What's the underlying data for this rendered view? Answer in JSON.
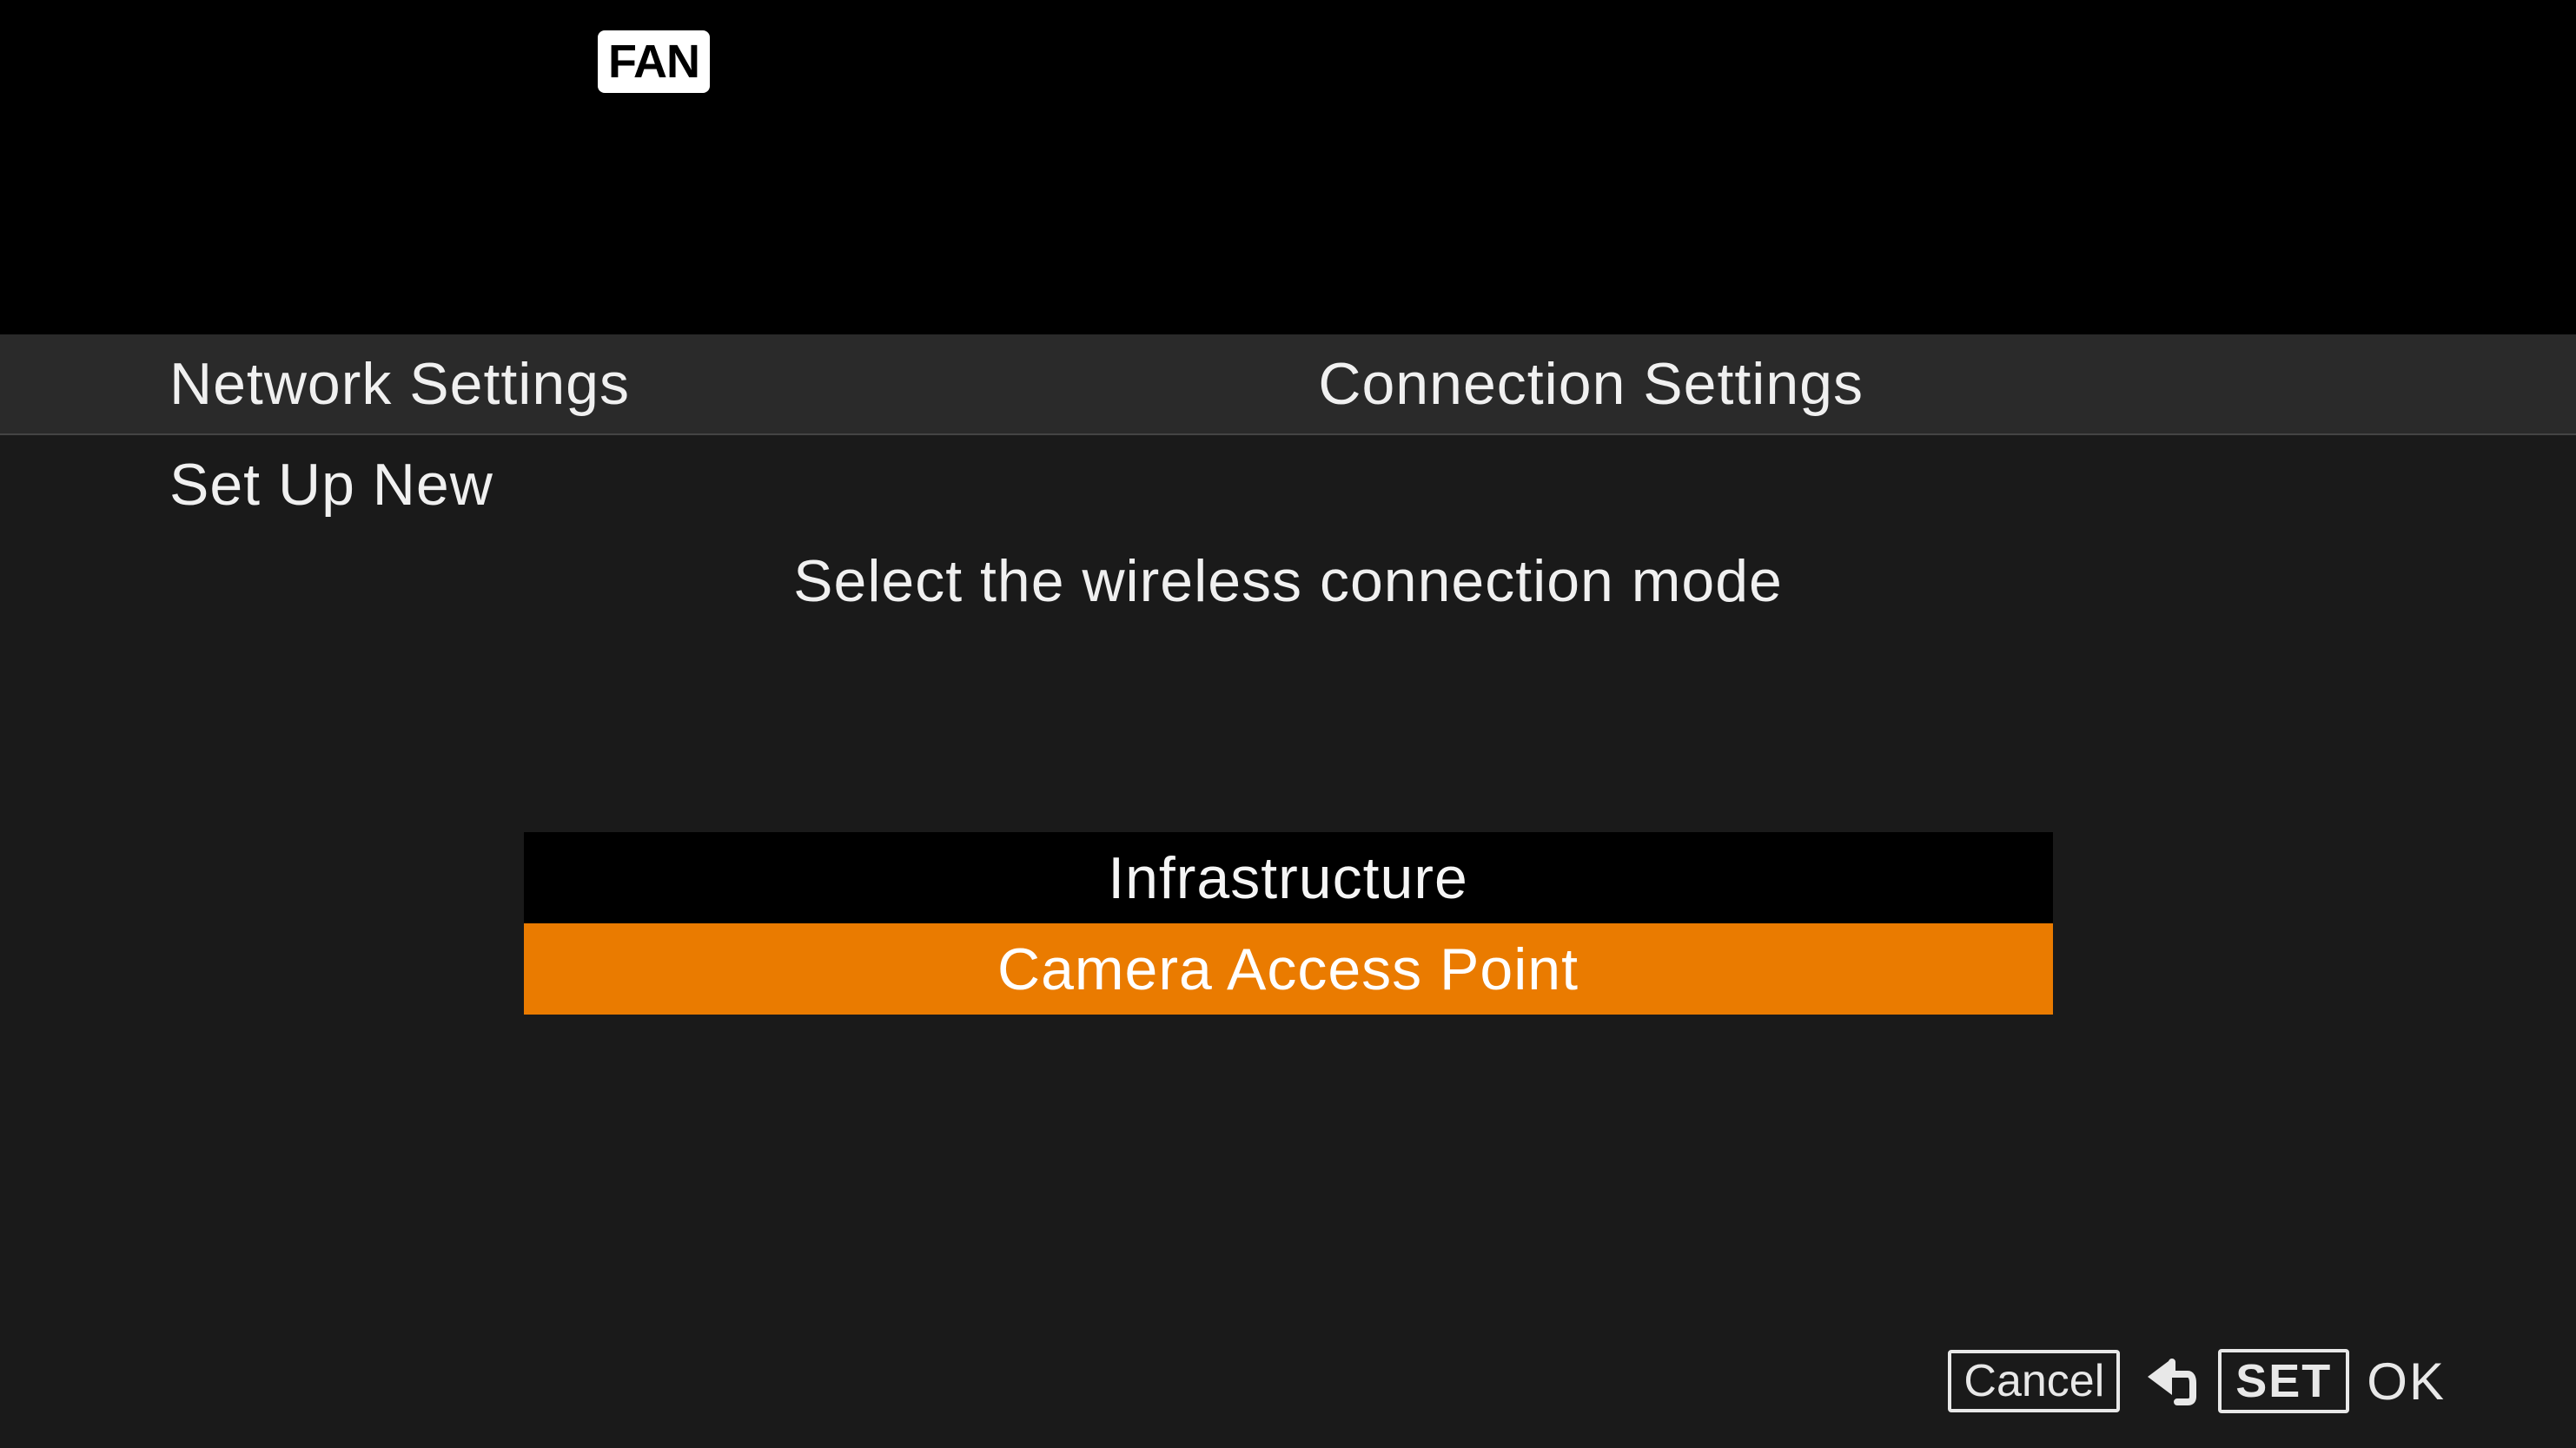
{
  "badge": {
    "fan": "FAN"
  },
  "header": {
    "left": "Network Settings",
    "right": "Connection Settings"
  },
  "subheader": {
    "text": "Set Up New"
  },
  "instruction": {
    "text": "Select the wireless connection mode"
  },
  "options": [
    {
      "label": "Infrastructure",
      "selected": false
    },
    {
      "label": "Camera Access Point",
      "selected": true
    }
  ],
  "footer": {
    "cancel": "Cancel",
    "set": "SET",
    "ok": "OK"
  }
}
